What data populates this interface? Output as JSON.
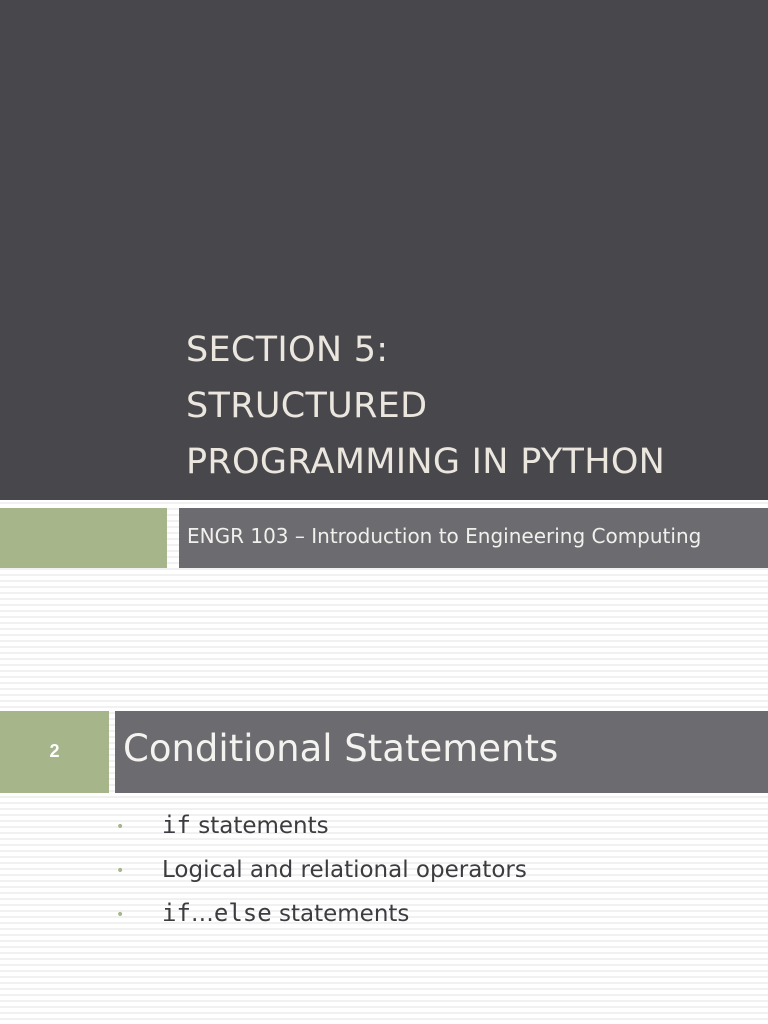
{
  "title_slide": {
    "title_lines": [
      "SECTION 5:",
      "STRUCTURED",
      "PROGRAMMING IN PYTHON"
    ],
    "subtitle": "ENGR 103 – Introduction to Engineering Computing"
  },
  "slide2": {
    "slide_number": "2",
    "heading": "Conditional Statements",
    "bullets": [
      {
        "code": "if",
        "text": " statements"
      },
      {
        "code": "",
        "text": "Logical and relational operators"
      },
      {
        "code": "if",
        "middle": "…",
        "code2": "else",
        "text": " statements"
      }
    ],
    "bullet_symbol": "•"
  },
  "colors": {
    "dark_gray": "#48474c",
    "mid_gray": "#6c6b70",
    "sage_green": "#a6b68a"
  }
}
